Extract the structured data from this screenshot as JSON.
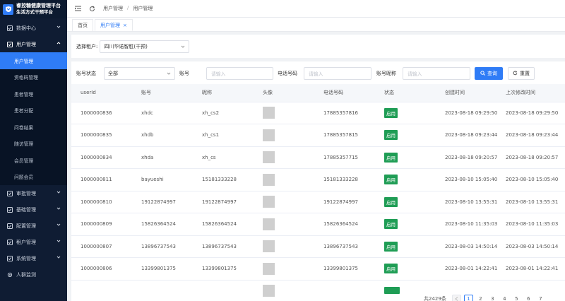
{
  "app": {
    "title_line1": "睿控糖健康管理平台",
    "title_line2": "生活方式干预平台"
  },
  "sidebar": {
    "items": [
      {
        "label": "数据中心",
        "icon": "checkbox-icon",
        "open": false
      },
      {
        "label": "用户管理",
        "icon": "checkbox-icon",
        "open": true
      },
      {
        "label": "审批管理",
        "icon": "checkbox-icon",
        "open": false
      },
      {
        "label": "基础管理",
        "icon": "checkbox-icon",
        "open": false
      },
      {
        "label": "配置管理",
        "icon": "checkbox-icon",
        "open": false
      },
      {
        "label": "租户管理",
        "icon": "checkbox-icon",
        "open": false
      },
      {
        "label": "系统管理",
        "icon": "checkbox-icon",
        "open": false
      },
      {
        "label": "人群监测",
        "icon": "gear-icon",
        "open": false
      }
    ],
    "submenu": [
      {
        "label": "用户管理",
        "active": true
      },
      {
        "label": "资格码管理",
        "active": false
      },
      {
        "label": "患者管理",
        "active": false
      },
      {
        "label": "患者分配",
        "active": false
      },
      {
        "label": "问卷结果",
        "active": false
      },
      {
        "label": "随访管理",
        "active": false
      },
      {
        "label": "会员管理",
        "active": false
      },
      {
        "label": "问题会员",
        "active": false
      }
    ]
  },
  "header": {
    "breadcrumb": [
      "用户管理",
      "用户管理"
    ],
    "breadcrumb_sep": "/"
  },
  "tabs": [
    {
      "label": "首页",
      "active": false
    },
    {
      "label": "用户管理",
      "active": true
    }
  ],
  "tenant": {
    "label": "选择租户:",
    "value": "四川华诺智胜(干预)"
  },
  "filter": {
    "status_label": "账号状态",
    "status_value": "全部",
    "account_label": "账号",
    "account_placeholder": "请输入",
    "phone_label": "电话号码",
    "phone_placeholder": "请输入",
    "nickname_label": "账号昵称",
    "nickname_placeholder": "请输入",
    "search_label": "查询",
    "reset_label": "重置"
  },
  "table": {
    "columns": [
      "userId",
      "账号",
      "昵称",
      "头像",
      "电话号码",
      "状态",
      "创建时间",
      "上次修改时间"
    ],
    "rows": [
      {
        "userId": "1000000836",
        "account": "xhdc",
        "nickname": "xh_cs2",
        "phone": "17885357816",
        "status": "启用",
        "created": "2023-08-18 09:29:50",
        "modified": "2023-08-18 09:29:50"
      },
      {
        "userId": "1000000835",
        "account": "xhdb",
        "nickname": "xh_cs1",
        "phone": "17885357815",
        "status": "启用",
        "created": "2023-08-18 09:23:44",
        "modified": "2023-08-18 09:23:44"
      },
      {
        "userId": "1000000834",
        "account": "xhda",
        "nickname": "xh_cs",
        "phone": "17885357715",
        "status": "启用",
        "created": "2023-08-18 09:20:57",
        "modified": "2023-08-18 09:20:57"
      },
      {
        "userId": "1000000811",
        "account": "bayueshi",
        "nickname": "15181333228",
        "phone": "15181333228",
        "status": "启用",
        "created": "2023-08-10 15:05:40",
        "modified": "2023-08-10 15:05:40"
      },
      {
        "userId": "1000000810",
        "account": "19122874997",
        "nickname": "19122874997",
        "phone": "19122874997",
        "status": "启用",
        "created": "2023-08-10 13:55:31",
        "modified": "2023-08-10 13:55:31"
      },
      {
        "userId": "1000000809",
        "account": "15826364524",
        "nickname": "15826364524",
        "phone": "15826364524",
        "status": "启用",
        "created": "2023-08-10 11:35:03",
        "modified": "2023-08-10 11:35:03"
      },
      {
        "userId": "1000000807",
        "account": "13896737543",
        "nickname": "13896737543",
        "phone": "13896737543",
        "status": "启用",
        "created": "2023-08-03 14:50:14",
        "modified": "2023-08-03 14:50:14"
      },
      {
        "userId": "1000000806",
        "account": "13399801375",
        "nickname": "13399801375",
        "phone": "13399801375",
        "status": "启用",
        "created": "2023-08-01 14:22:41",
        "modified": "2023-08-01 14:22:41"
      },
      {
        "userId": "",
        "account": "",
        "nickname": "",
        "phone": "",
        "status": "",
        "created": "",
        "modified": ""
      }
    ]
  },
  "pagination": {
    "total": "共2429条",
    "pages": [
      "1",
      "2",
      "3",
      "4",
      "5",
      "6",
      "7"
    ],
    "current": "1"
  },
  "colors": {
    "sidebar_bg": "#0f1c33",
    "accent": "#2f7cf6",
    "status_green": "#1f9d55"
  }
}
